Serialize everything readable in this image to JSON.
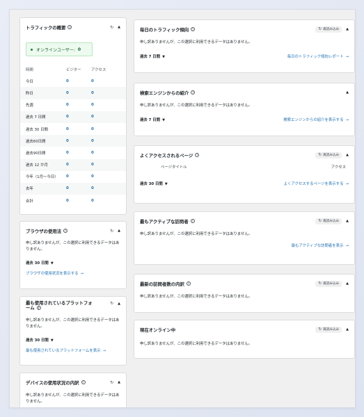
{
  "traffic": {
    "title": "トラフィックの概要",
    "online_label": "オンラインユーザー:",
    "online_count": "0",
    "headers": [
      "時間",
      "ビジター",
      "アクセス"
    ],
    "rows": [
      {
        "period": "今日",
        "visitors": "0",
        "visits": "0"
      },
      {
        "period": "昨日",
        "visitors": "0",
        "visits": "0"
      },
      {
        "period": "先週",
        "visitors": "0",
        "visits": "0"
      },
      {
        "period": "過去 7 日間",
        "visitors": "0",
        "visits": "0"
      },
      {
        "period": "過去 30 日間",
        "visitors": "0",
        "visits": "0"
      },
      {
        "period": "過去60日間",
        "visitors": "0",
        "visits": "0"
      },
      {
        "period": "過去90日間",
        "visitors": "0",
        "visits": "0"
      },
      {
        "period": "過去 12 か月",
        "visitors": "0",
        "visits": "0"
      },
      {
        "period": "今年（1月〜今日）",
        "visitors": "0",
        "visits": "0"
      },
      {
        "period": "去年",
        "visitors": "0",
        "visits": "0"
      },
      {
        "period": "合計",
        "visitors": "0",
        "visits": "0"
      }
    ]
  },
  "browser": {
    "title": "ブラウザの使用法",
    "message": "申し訳ありませんが、この選択に利用できるデータはありません。",
    "period": "過去 30 日間",
    "link": "ブラウザの使用状況を表示する"
  },
  "platform": {
    "title": "最も使用されているプラットフォーム",
    "message": "申し訳ありませんが、この選択に利用できるデータはありません。",
    "period": "過去 30 日間",
    "link": "最も使用されているプラットフォームを表示"
  },
  "device": {
    "title": "デバイスの使用状況の内訳",
    "message": "申し訳ありませんが、この選択に利用できるデータはありません。"
  },
  "common": {
    "reload": "再読み込み"
  },
  "daily": {
    "title": "毎日のトラフィック傾向",
    "message": "申し訳ありませんが、この選択に利用できるデータはありません。",
    "period": "過去 7 日間",
    "link": "毎日のトラフィック傾向レポート"
  },
  "search": {
    "title": "検索エンジンからの紹介",
    "message": "申し訳ありませんが、この選択に利用できるデータはありません。",
    "period": "過去 7 日間",
    "link": "検索エンジンからの紹介を表示する"
  },
  "pages": {
    "title": "よくアクセスされるページ",
    "col_page": "ページタイトル",
    "col_visits": "アクセス",
    "period": "過去 30 日間",
    "link": "よくアクセスするページを表示する"
  },
  "active": {
    "title": "最もアクティブな訪問者",
    "message": "申し訳ありませんが、この選択に利用できるデータはありません。",
    "link": "最もアクティブな訪問者を表示"
  },
  "recent": {
    "title": "最新の訪問者数の内訳",
    "message": "申し訳ありませんが、この選択に利用できるデータはありません。"
  },
  "online_now": {
    "title": "現在オンライン中",
    "message": "申し訳ありませんが、この選択に利用できるデータはありません。"
  }
}
